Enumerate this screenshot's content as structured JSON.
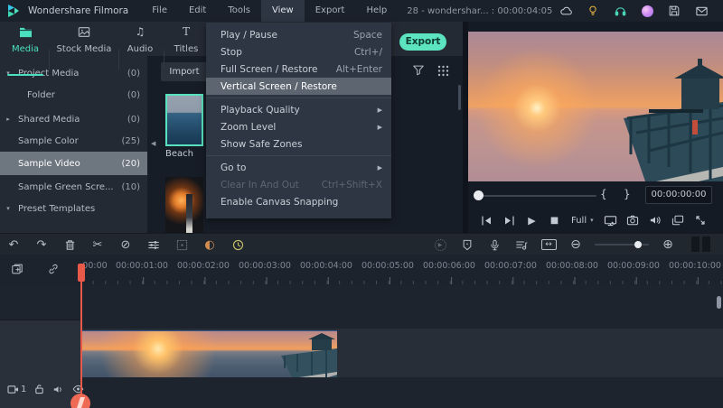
{
  "colors": {
    "accent_teal": "#4ae0bf",
    "export_green": "#5ce3bf",
    "playhead_red": "#e8594a",
    "menu_highlight": "#5d6670"
  },
  "menubar": {
    "app_title": "Wondershare Filmora",
    "menus": {
      "file": "File",
      "edit": "Edit",
      "tools": "Tools",
      "view": "View",
      "export": "Export",
      "help": "Help"
    },
    "document_title": "28 - wondershar... : 00:00:04:05",
    "window": {
      "minimize": "−",
      "maximize": "□",
      "close": "×"
    }
  },
  "tabs": {
    "media": "Media",
    "stock": "Stock Media",
    "audio": "Audio",
    "titles": "Titles"
  },
  "export_button": "Export",
  "sidebar": {
    "items": [
      {
        "label": "Project Media",
        "count": "(0)",
        "tri": "▾"
      },
      {
        "label": "Folder",
        "count": "(0)",
        "tri": ""
      },
      {
        "label": "Shared Media",
        "count": "(0)",
        "tri": "▸"
      },
      {
        "label": "Sample Color",
        "count": "(25)",
        "tri": ""
      },
      {
        "label": "Sample Video",
        "count": "(20)",
        "tri": ""
      },
      {
        "label": "Sample Green Scre...",
        "count": "(10)",
        "tri": ""
      },
      {
        "label": "Preset Templates",
        "count": "",
        "tri": "▾"
      }
    ]
  },
  "media_panel": {
    "import_label": "Import",
    "clips": [
      {
        "name": "Beach"
      }
    ]
  },
  "view_menu": {
    "items": [
      {
        "label": "Play / Pause",
        "shortcut": "Space"
      },
      {
        "label": "Stop",
        "shortcut": "Ctrl+/"
      },
      {
        "label": "Full Screen / Restore",
        "shortcut": "Alt+Enter"
      },
      {
        "label": "Vertical Screen / Restore",
        "shortcut": ""
      },
      {
        "label": "Playback Quality",
        "shortcut": "▶"
      },
      {
        "label": "Zoom Level",
        "shortcut": "▶"
      },
      {
        "label": "Show Safe Zones",
        "shortcut": ""
      },
      {
        "label": "Go to",
        "shortcut": "▶"
      },
      {
        "label": "Clear In And Out",
        "shortcut": "Ctrl+Shift+X"
      },
      {
        "label": "Enable Canvas Snapping",
        "shortcut": ""
      }
    ]
  },
  "preview": {
    "timecode": "00:00:00:00",
    "quality_selected": "Full",
    "mark_in": "{",
    "mark_out": "}",
    "play_glyph": "▶",
    "stop_glyph": "■"
  },
  "timeline": {
    "ruler_labels": [
      "00:00",
      "00:00:01:00",
      "00:00:02:00",
      "00:00:03:00",
      "00:00:04:00",
      "00:00:05:00",
      "00:00:06:00",
      "00:00:07:00",
      "00:00:08:00",
      "00:00:09:00",
      "00:00:10:00"
    ],
    "track_number": "1"
  },
  "toolbar_glyphs": {
    "undo": "↶",
    "redo": "↷",
    "scissors": "✂",
    "crop": "⊘",
    "keyframe": "◐",
    "zoom_out": "⊖",
    "zoom_in": "⊕",
    "fit": "↔",
    "render_play": "▶"
  }
}
